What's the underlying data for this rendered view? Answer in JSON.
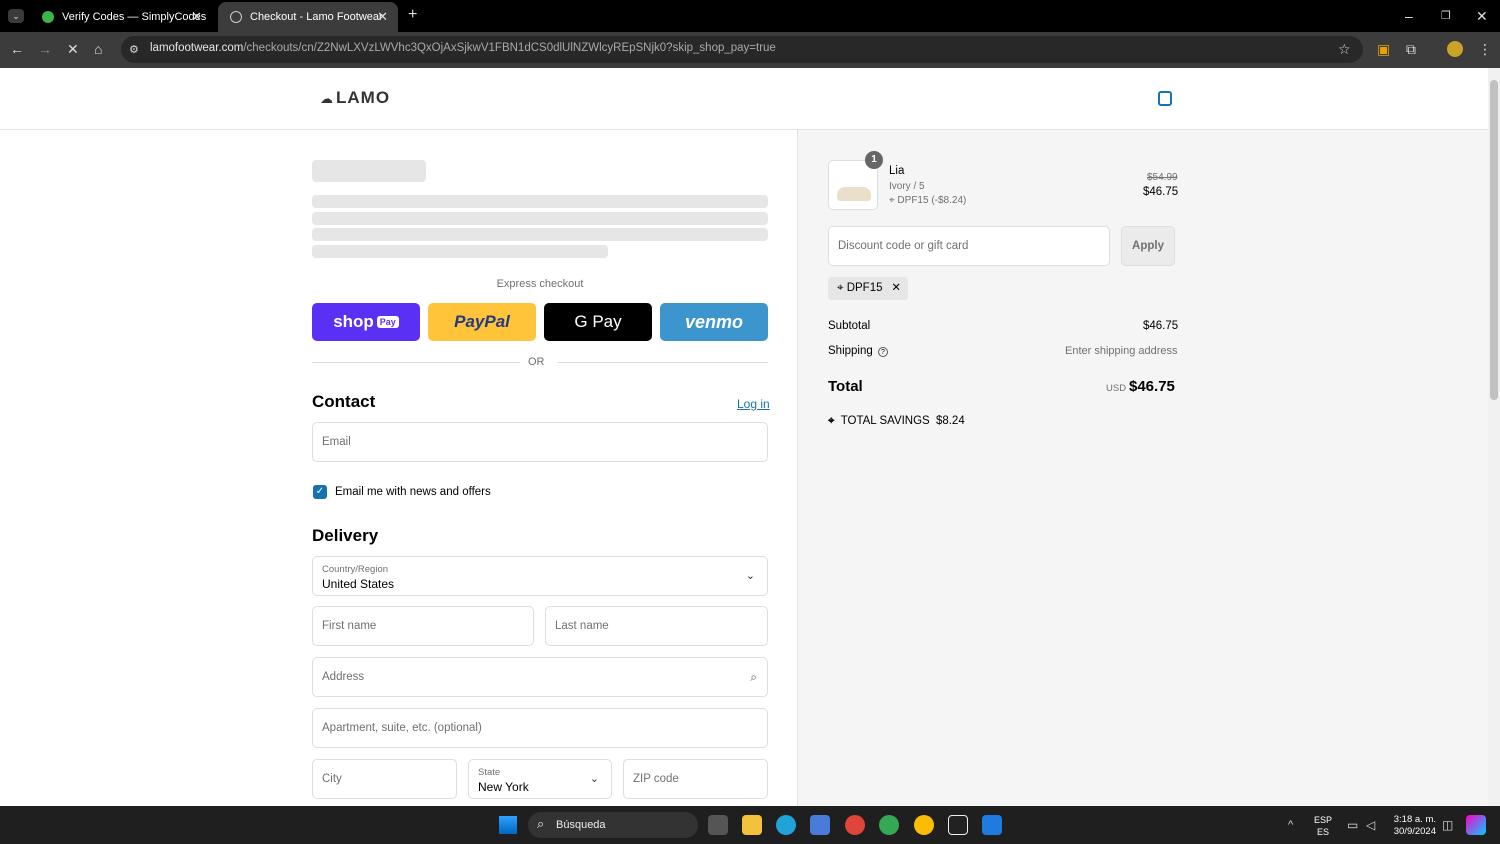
{
  "browser": {
    "tabs": [
      {
        "title": "Verify Codes — SimplyCodes",
        "active": false
      },
      {
        "title": "Checkout - Lamo Footwear",
        "active": true
      }
    ],
    "url_domain": "lamofootwear.com",
    "url_path": "/checkouts/cn/Z2NwLXVzLWVhc3QxOjAxSjkwV1FBN1dCS0dlUlNZWlcyREpSNjk0?skip_shop_pay=true"
  },
  "header": {
    "logo": "LAMO"
  },
  "express": {
    "label": "Express checkout",
    "shop_pay": "shop",
    "shop_pay_badge": "Pay",
    "paypal": "PayPal",
    "gpay": "G Pay",
    "venmo": "venmo",
    "or": "OR"
  },
  "contact": {
    "title": "Contact",
    "login": "Log in",
    "email_placeholder": "Email",
    "newsletter_label": "Email me with news and offers"
  },
  "delivery": {
    "title": "Delivery",
    "country_label": "Country/Region",
    "country_value": "United States",
    "first_name": "First name",
    "last_name": "Last name",
    "address": "Address",
    "apartment": "Apartment, suite, etc. (optional)",
    "city": "City",
    "state_label": "State",
    "state_value": "New York",
    "zip": "ZIP code"
  },
  "order": {
    "quantity": "1",
    "product_name": "Lia",
    "variant": "Ivory / 5",
    "discount_tag": "DPF15 (-$8.24)",
    "original_price": "$54.99",
    "price": "$46.75",
    "discount_placeholder": "Discount code or gift card",
    "apply": "Apply",
    "applied_code": "DPF15",
    "subtotal_label": "Subtotal",
    "subtotal_value": "$46.75",
    "shipping_label": "Shipping",
    "shipping_value": "Enter shipping address",
    "total_label": "Total",
    "currency": "USD",
    "total_value": "$46.75",
    "savings_label": "TOTAL SAVINGS",
    "savings_value": "$8.24"
  },
  "taskbar": {
    "search": "Búsqueda",
    "lang1": "ESP",
    "lang2": "ES",
    "time": "3:18 a. m.",
    "date": "30/9/2024"
  }
}
